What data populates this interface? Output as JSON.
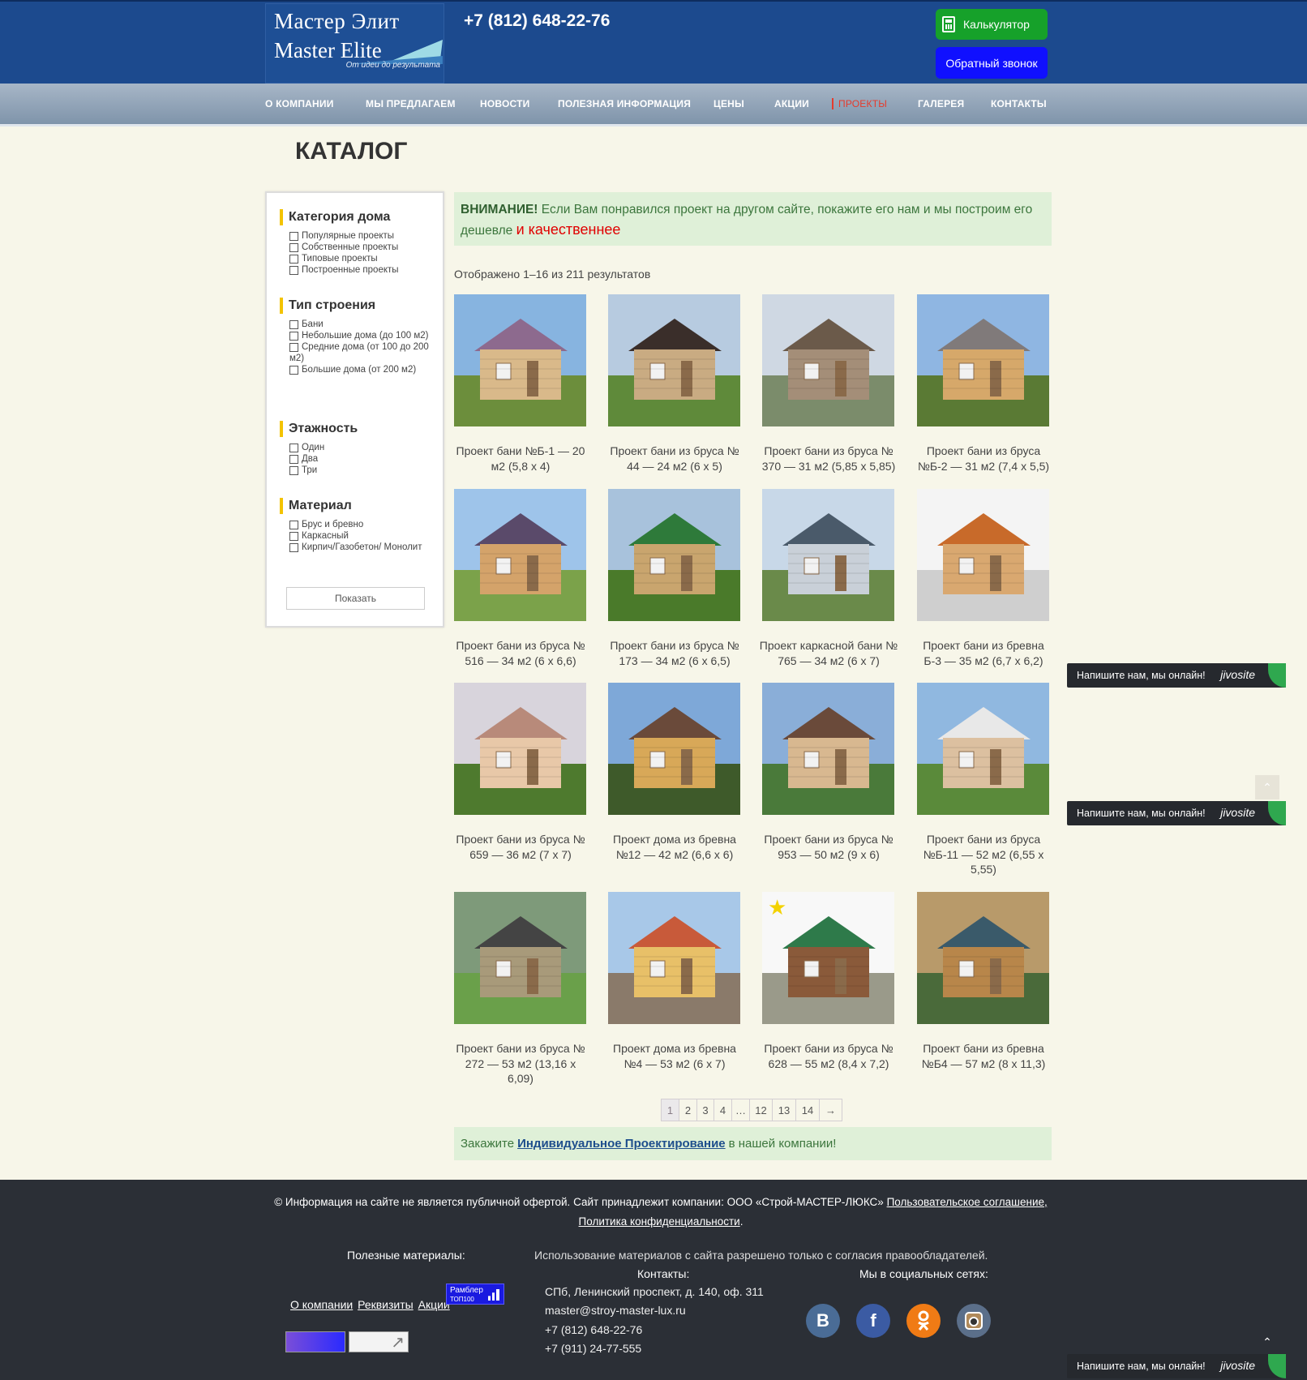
{
  "header": {
    "logo_line1": "Мастер Элит",
    "logo_line2": "Master Elite",
    "logo_slogan": "От идеи до результата",
    "phone": "+7 (812) 648-22-76",
    "calc_button": "Калькулятор",
    "callback_button": "Обратный звонок"
  },
  "nav": [
    "О КОМПАНИИ",
    "МЫ ПРЕДЛАГАЕМ",
    "НОВОСТИ",
    "ПОЛЕЗНАЯ ИНФОРМАЦИЯ",
    "ЦЕНЫ",
    "АКЦИИ",
    "ПРОЕКТЫ",
    "ГАЛЕРЕЯ",
    "КОНТАКТЫ"
  ],
  "active_nav": "ПРОЕКТЫ",
  "page_title": "КАТАЛОГ",
  "filters": {
    "category": {
      "title": "Категория дома",
      "options": [
        "Популярные проекты",
        "Собственные проекты",
        "Типовые проекты",
        "Построенные проекты"
      ]
    },
    "type": {
      "title": "Тип строения",
      "options": [
        "Бани",
        "Небольшие дома (до 100 м2)",
        "Средние дома (от 100 до 200 м2)",
        "Большие дома (от 200 м2)"
      ]
    },
    "floors": {
      "title": "Этажность",
      "options": [
        "Один",
        "Два",
        "Три"
      ]
    },
    "material": {
      "title": "Материал",
      "options": [
        "Брус и бревно",
        "Каркасный",
        "Кирпич/Газобетон/ Монолит"
      ]
    },
    "show_button": "Показать"
  },
  "notice": {
    "bold": "ВНИМАНИЕ!",
    "text": " Если Вам понравился проект на другом сайте, покажите его нам и мы построим его дешевле ",
    "red": "и качественнее"
  },
  "result_count": "Отображено 1–16 из 211 результатов",
  "products": [
    "Проект бани №Б-1 — 20 м2 (5,8 х 4)",
    "Проект бани из бруса № 44 — 24 м2 (6 х 5)",
    "Проект бани из бруса № 370 — 31 м2 (5,85 х 5,85)",
    "Проект бани из бруса №Б-2 — 31 м2 (7,4 х 5,5)",
    "Проект бани из бруса № 516 — 34 м2 (6 х 6,6)",
    "Проект бани из бруса № 173 — 34 м2 (6 х 6,5)",
    "Проект каркасной бани № 765 — 34 м2 (6 х 7)",
    "Проект бани из бревна Б-3 — 35 м2 (6,7 х 6,2)",
    "Проект бани из бруса № 659 — 36 м2 (7 х 7)",
    "Проект дома из бревна №12 — 42 м2 (6,6 х 6)",
    "Проект бани из бруса № 953 — 50 м2 (9 х 6)",
    "Проект бани из бруса №Б-11 — 52 м2 (6,55 х 5,55)",
    "Проект бани из бруса № 272 — 53 м2 (13,16 х 6,09)",
    "Проект дома из бревна №4 — 53 м2 (6 х 7)",
    "Проект бани из бруса № 628 — 55 м2 (8,4 х 7,2)",
    "Проект бани из бревна №Б4 — 57 м2 (8 х 11,3)"
  ],
  "pagination": [
    "1",
    "2",
    "3",
    "4",
    "…",
    "12",
    "13",
    "14",
    "→"
  ],
  "order": {
    "before": "Закажите",
    "link": "Индивидуальное Проектирование",
    "after": "в нашей компании!"
  },
  "footer": {
    "legal_text": "© Информация на сайте не является публичной офертой.  Сайт принадлежит компании: ООО «Строй-МАСТЕР-ЛЮКС»",
    "legal_link1": "Пользовательское соглашение,",
    "legal_link2": "Политика конфиденциальности",
    "useful_title": "Полезные материалы:",
    "copyright": "Использование материалов с сайта разрешено только с согласия правообладателей.",
    "contacts_title": "Контакты:",
    "social_title": "Мы в социальных сетях:",
    "links": [
      "О компании",
      "Реквизиты",
      "Акции"
    ],
    "rambler_line1": "Рамблер",
    "rambler_line2": "ТОП100",
    "address": "СПб, Ленинский проспект, д. 140, оф. 311",
    "email": "master@stroy-master-lux.ru",
    "phone1": "+7 (812) 648-22-76",
    "phone2": "+7 (911) 24-77-555"
  },
  "jivo": {
    "text": "Напишите нам, мы онлайн!",
    "brand": "jivosite"
  },
  "colors": {
    "header": "#1c4a8e",
    "calc": "#16a12a",
    "callback": "#1010ff",
    "active_nav": "#e53b2c",
    "notice_bg": "#dff0d8",
    "footer": "#2b2f36"
  }
}
